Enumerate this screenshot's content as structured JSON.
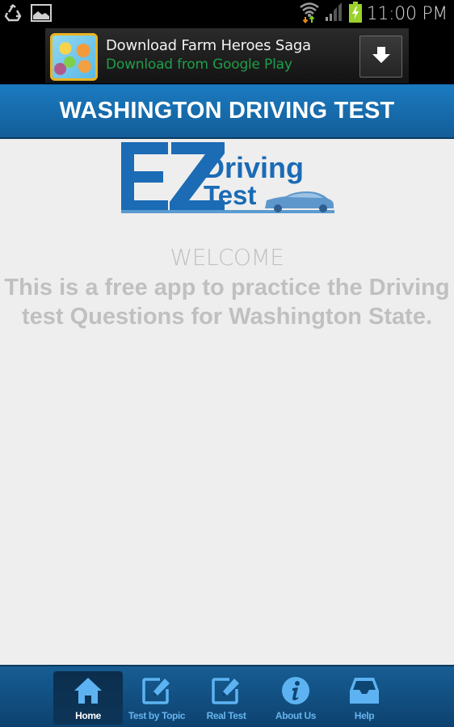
{
  "status_bar": {
    "time": "11:00 PM",
    "left_icons": [
      "recycle-icon",
      "image-icon"
    ],
    "right_icons": [
      "wifi-icon",
      "signal-icon",
      "battery-charging-icon"
    ]
  },
  "ad": {
    "title": "Download Farm Heroes Saga",
    "subtitle": "Download from Google Play",
    "icon": "farm-heroes-app-icon",
    "button_icon": "download-arrow-icon"
  },
  "header": {
    "title": "WASHINGTON DRIVING TEST",
    "color": "#1a75b8"
  },
  "logo": {
    "letters": "EZ",
    "line1": "Driving",
    "line2": "Test",
    "color": "#1a6cb5"
  },
  "main": {
    "welcome": "WELCOME",
    "intro": "This is a free app to practice the Driving test Questions for Washington State."
  },
  "bottom_nav": {
    "items": [
      {
        "label": "Home",
        "icon": "home-icon",
        "active": true
      },
      {
        "label": "Test by Topic",
        "icon": "edit-icon",
        "active": false
      },
      {
        "label": "Real Test",
        "icon": "edit-icon",
        "active": false
      },
      {
        "label": "About Us",
        "icon": "info-icon",
        "active": false
      },
      {
        "label": "Help",
        "icon": "inbox-icon",
        "active": false
      }
    ],
    "active_color": "#ffffff",
    "inactive_color": "#67b4ec"
  }
}
